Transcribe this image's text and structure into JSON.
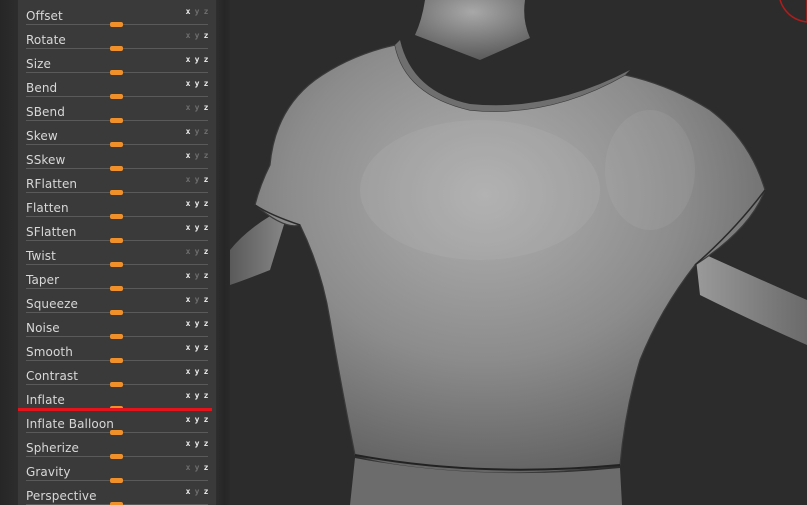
{
  "deformation_panel": {
    "items": [
      {
        "label": "Offset",
        "axes": [
          true,
          false,
          false
        ]
      },
      {
        "label": "Rotate",
        "axes": [
          false,
          false,
          true
        ]
      },
      {
        "label": "Size",
        "axes": [
          true,
          true,
          true
        ]
      },
      {
        "label": "Bend",
        "axes": [
          true,
          true,
          true
        ]
      },
      {
        "label": "SBend",
        "axes": [
          false,
          false,
          true
        ]
      },
      {
        "label": "Skew",
        "axes": [
          true,
          false,
          false
        ]
      },
      {
        "label": "SSkew",
        "axes": [
          true,
          false,
          false
        ]
      },
      {
        "label": "RFlatten",
        "axes": [
          false,
          false,
          true
        ]
      },
      {
        "label": "Flatten",
        "axes": [
          true,
          true,
          true
        ]
      },
      {
        "label": "SFlatten",
        "axes": [
          true,
          true,
          true
        ]
      },
      {
        "label": "Twist",
        "axes": [
          false,
          false,
          true
        ]
      },
      {
        "label": "Taper",
        "axes": [
          true,
          false,
          true
        ]
      },
      {
        "label": "Squeeze",
        "axes": [
          true,
          false,
          true
        ]
      },
      {
        "label": "Noise",
        "axes": [
          true,
          true,
          true
        ]
      },
      {
        "label": "Smooth",
        "axes": [
          true,
          true,
          true
        ]
      },
      {
        "label": "Contrast",
        "axes": [
          true,
          true,
          true
        ]
      },
      {
        "label": "Inflate",
        "axes": [
          true,
          true,
          true
        ]
      },
      {
        "label": "Inflate Balloon",
        "axes": [
          true,
          true,
          true
        ]
      },
      {
        "label": "Spherize",
        "axes": [
          true,
          true,
          true
        ]
      },
      {
        "label": "Gravity",
        "axes": [
          false,
          false,
          true
        ]
      },
      {
        "label": "Perspective",
        "axes": [
          true,
          false,
          true
        ]
      }
    ],
    "axis_glyphs": {
      "x": "x",
      "y": "y",
      "z": "z"
    },
    "slider_value": 0.5,
    "highlighted_item": "Inflate"
  },
  "viewport": {
    "subject": "3D sculpted torso mesh with t-shirt",
    "background_color": "#2c2c2c",
    "mesh_color": "#8a8a8a"
  },
  "colors": {
    "panel_bg": "#3a3a3a",
    "slider_thumb": "#f0902a",
    "highlight_line": "#e3141b",
    "label_text": "#d8d8d8"
  }
}
